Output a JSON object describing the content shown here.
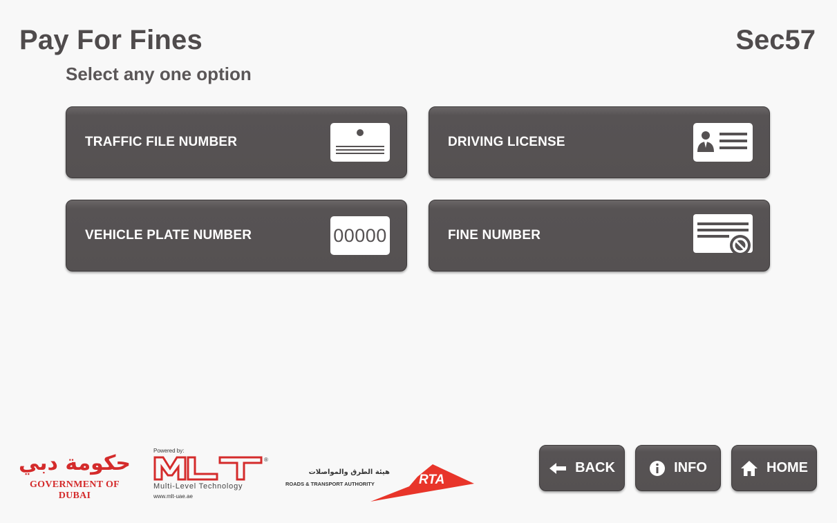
{
  "header": {
    "title": "Pay For Fines",
    "session_id": "Sec57",
    "subtitle": "Select any one option"
  },
  "options": [
    {
      "label": "TRAFFIC FILE NUMBER",
      "icon": "id-card-icon"
    },
    {
      "label": "DRIVING LICENSE",
      "icon": "driving-license-icon"
    },
    {
      "label": "VEHICLE PLATE NUMBER",
      "icon": "plate-number-icon",
      "icon_text": "00000"
    },
    {
      "label": "FINE NUMBER",
      "icon": "fine-ticket-icon"
    }
  ],
  "nav": {
    "back_label": "BACK",
    "info_label": "INFO",
    "home_label": "HOME"
  },
  "logos": {
    "gov_arabic": "حكومة دبي",
    "gov_english": "GOVERNMENT OF DUBAI",
    "mlt_powered": "Powered by:",
    "mlt_name": "MLT",
    "mlt_sub": "Multi-Level Technology",
    "mlt_url": "www.mlt-uae.ae",
    "rta_arabic": "هيئة الطرق والمواصلات",
    "rta_english": "ROADS & TRANSPORT AUTHORITY",
    "rta_short": "RTA"
  },
  "colors": {
    "button_bg": "#555152",
    "page_bg": "#f8f8f8",
    "gov_red": "#d42b2b",
    "rta_red": "#e8352a"
  }
}
